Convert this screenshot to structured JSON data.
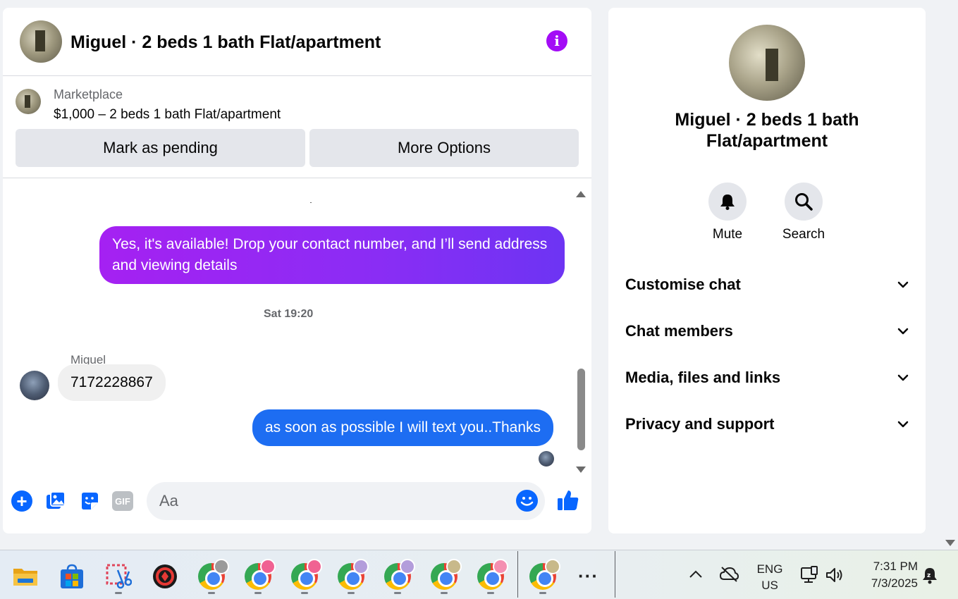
{
  "chat": {
    "title": "Miguel · 2 beds 1 bath Flat/apartment",
    "listing": {
      "kind": "Marketplace",
      "description": "$1,000 – 2 beds 1 bath Flat/apartment",
      "mark_pending_label": "Mark as pending",
      "more_options_label": "More Options"
    },
    "messages": [
      {
        "direction": "outgoing",
        "text": "Yes, it's available! Drop your contact number, and I’ll send address and viewing details"
      },
      {
        "direction": "timestamp",
        "text": "Sat 19:20"
      },
      {
        "direction": "incoming",
        "sender": "Miguel",
        "text": "7172228867"
      },
      {
        "direction": "outgoing",
        "text": "as soon as possible I will text you..Thanks"
      }
    ],
    "composer": {
      "placeholder": "Aa",
      "gif_label": "GIF"
    }
  },
  "info_panel": {
    "title": "Miguel · 2 beds 1 bath Flat/apartment",
    "actions": [
      {
        "label": "Mute",
        "icon": "bell-icon"
      },
      {
        "label": "Search",
        "icon": "search-icon"
      }
    ],
    "sections": [
      {
        "label": "Customise chat"
      },
      {
        "label": "Chat members"
      },
      {
        "label": "Media, files and links"
      },
      {
        "label": "Privacy and support"
      }
    ]
  },
  "taskbar": {
    "apps": [
      {
        "name": "file-explorer-icon"
      },
      {
        "name": "microsoft-store-icon"
      },
      {
        "name": "snipping-tool-icon"
      },
      {
        "name": "red-app-icon"
      },
      {
        "name": "chrome-icon",
        "profile_color": "#9a9a9a"
      },
      {
        "name": "chrome-icon",
        "profile_color": "#f06292"
      },
      {
        "name": "chrome-icon",
        "profile_color": "#f06292"
      },
      {
        "name": "chrome-icon",
        "profile_color": "#b39ddb"
      },
      {
        "name": "chrome-icon",
        "profile_color": "#b39ddb"
      },
      {
        "name": "chrome-icon",
        "profile_color": "#c8b98a"
      },
      {
        "name": "chrome-icon",
        "profile_color": "#f48fb1"
      },
      {
        "name": "chrome-icon",
        "profile_color": "#c8b98a"
      }
    ],
    "lang_line1": "ENG",
    "lang_line2": "US",
    "time": "7:31 PM",
    "date": "7/3/2025"
  },
  "colors": {
    "accent_purple": "#a30cf6",
    "outgoing_blue": "#1d6df2",
    "messenger_blue": "#0866ff"
  }
}
